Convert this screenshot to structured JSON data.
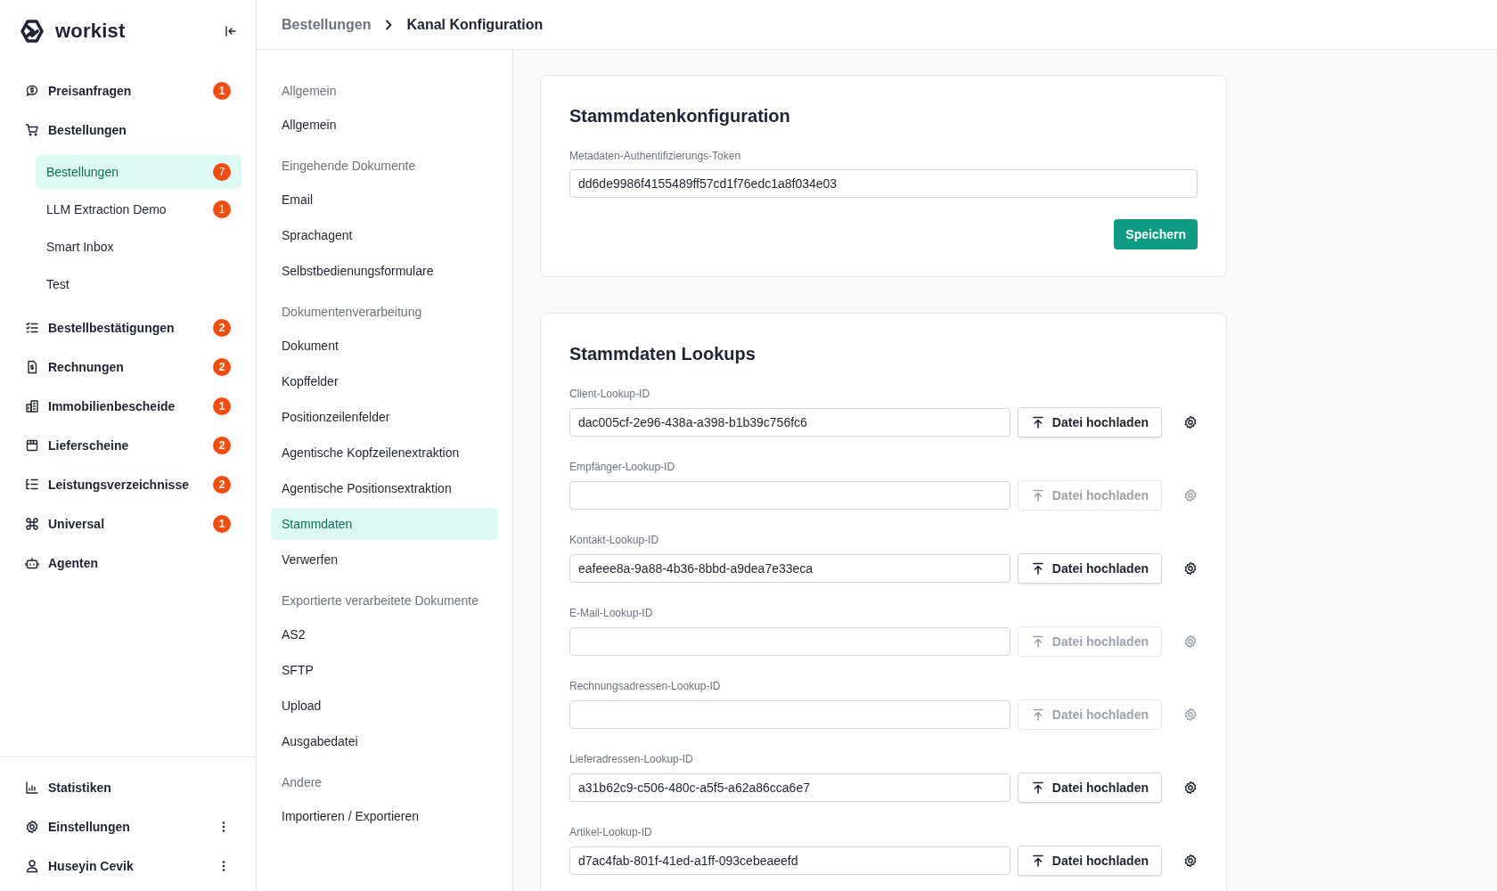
{
  "brand": {
    "name": "workist"
  },
  "sidebar": {
    "items": [
      {
        "label": "Preisanfragen",
        "badge": "1"
      },
      {
        "label": "Bestellungen",
        "children": [
          {
            "label": "Bestellungen",
            "badge": "7",
            "selected": true
          },
          {
            "label": "LLM Extraction Demo",
            "badge": "1",
            "selected": false
          },
          {
            "label": "Smart Inbox",
            "selected": false
          },
          {
            "label": "Test",
            "selected": false
          }
        ]
      },
      {
        "label": "Bestellbestätigungen",
        "badge": "2"
      },
      {
        "label": "Rechnungen",
        "badge": "2"
      },
      {
        "label": "Immobilienbescheide",
        "badge": "1"
      },
      {
        "label": "Lieferscheine",
        "badge": "2"
      },
      {
        "label": "Leistungsverzeichnisse",
        "badge": "2"
      },
      {
        "label": "Universal",
        "badge": "1"
      },
      {
        "label": "Agenten"
      }
    ],
    "bottom_items": [
      {
        "label": "Statistiken",
        "menu": false
      },
      {
        "label": "Einstellungen",
        "menu": true
      },
      {
        "label": "Huseyin Cevik",
        "menu": true
      }
    ]
  },
  "breadcrumb": [
    "Bestellungen",
    "Kanal Konfiguration"
  ],
  "config_nav": [
    {
      "heading": "Allgemein",
      "items": [
        {
          "label": "Allgemein",
          "selected": false
        }
      ]
    },
    {
      "heading": "Eingehende Dokumente",
      "items": [
        {
          "label": "Email",
          "selected": false
        },
        {
          "label": "Sprachagent",
          "selected": false
        },
        {
          "label": "Selbstbedienungsformulare",
          "selected": false
        }
      ]
    },
    {
      "heading": "Dokumentenverarbeitung",
      "items": [
        {
          "label": "Dokument",
          "selected": false
        },
        {
          "label": "Kopffelder",
          "selected": false
        },
        {
          "label": "Positionzeilenfelder",
          "selected": false
        },
        {
          "label": "Agentische Kopfzeilenextraktion",
          "selected": false
        },
        {
          "label": "Agentische Positionsextraktion",
          "selected": false
        },
        {
          "label": "Stammdaten",
          "selected": true
        },
        {
          "label": "Verwerfen",
          "selected": false
        }
      ]
    },
    {
      "heading": "Exportierte verarbeitete Dokumente",
      "items": [
        {
          "label": "AS2",
          "selected": false
        },
        {
          "label": "SFTP",
          "selected": false
        },
        {
          "label": "Upload",
          "selected": false
        },
        {
          "label": "Ausgabedatei",
          "selected": false
        }
      ]
    },
    {
      "heading": "Andere",
      "items": [
        {
          "label": "Importieren / Exportieren",
          "selected": false
        }
      ]
    }
  ],
  "master_data_config": {
    "title": "Stammdatenkonfiguration",
    "token_label": "Metadaten-Authentifizierungs-Token",
    "token_value": "dd6de9986f4155489ff57cd1f76edc1a8f034e03",
    "save_button": "Speichern"
  },
  "master_data_lookups": {
    "title": "Stammdaten Lookups",
    "rows": [
      {
        "label": "Client-Lookup-ID",
        "value": "dac005cf-2e96-438a-a398-b1b39c756fc6",
        "button": "Datei hochladen",
        "disabled": false
      },
      {
        "label": "Empfänger-Lookup-ID",
        "button": "Datei hochladen",
        "disabled": true
      },
      {
        "label": "Kontakt-Lookup-ID",
        "value": "eafeee8a-9a88-4b36-8bbd-a9dea7e33eca",
        "button": "Datei hochladen",
        "disabled": false
      },
      {
        "label": "E-Mail-Lookup-ID",
        "button": "Datei hochladen",
        "disabled": true
      },
      {
        "label": "Rechnungsadressen-Lookup-ID",
        "button": "Datei hochladen",
        "disabled": true
      },
      {
        "label": "Lieferadressen-Lookup-ID",
        "value": "a31b62c9-c506-480c-a5f5-a62a86cca6e7",
        "button": "Datei hochladen",
        "disabled": false
      },
      {
        "label": "Artikel-Lookup-ID",
        "value": "d7ac4fab-801f-41ed-a1ff-093cebeaeefd",
        "button": "Datei hochladen",
        "disabled": false
      }
    ]
  }
}
